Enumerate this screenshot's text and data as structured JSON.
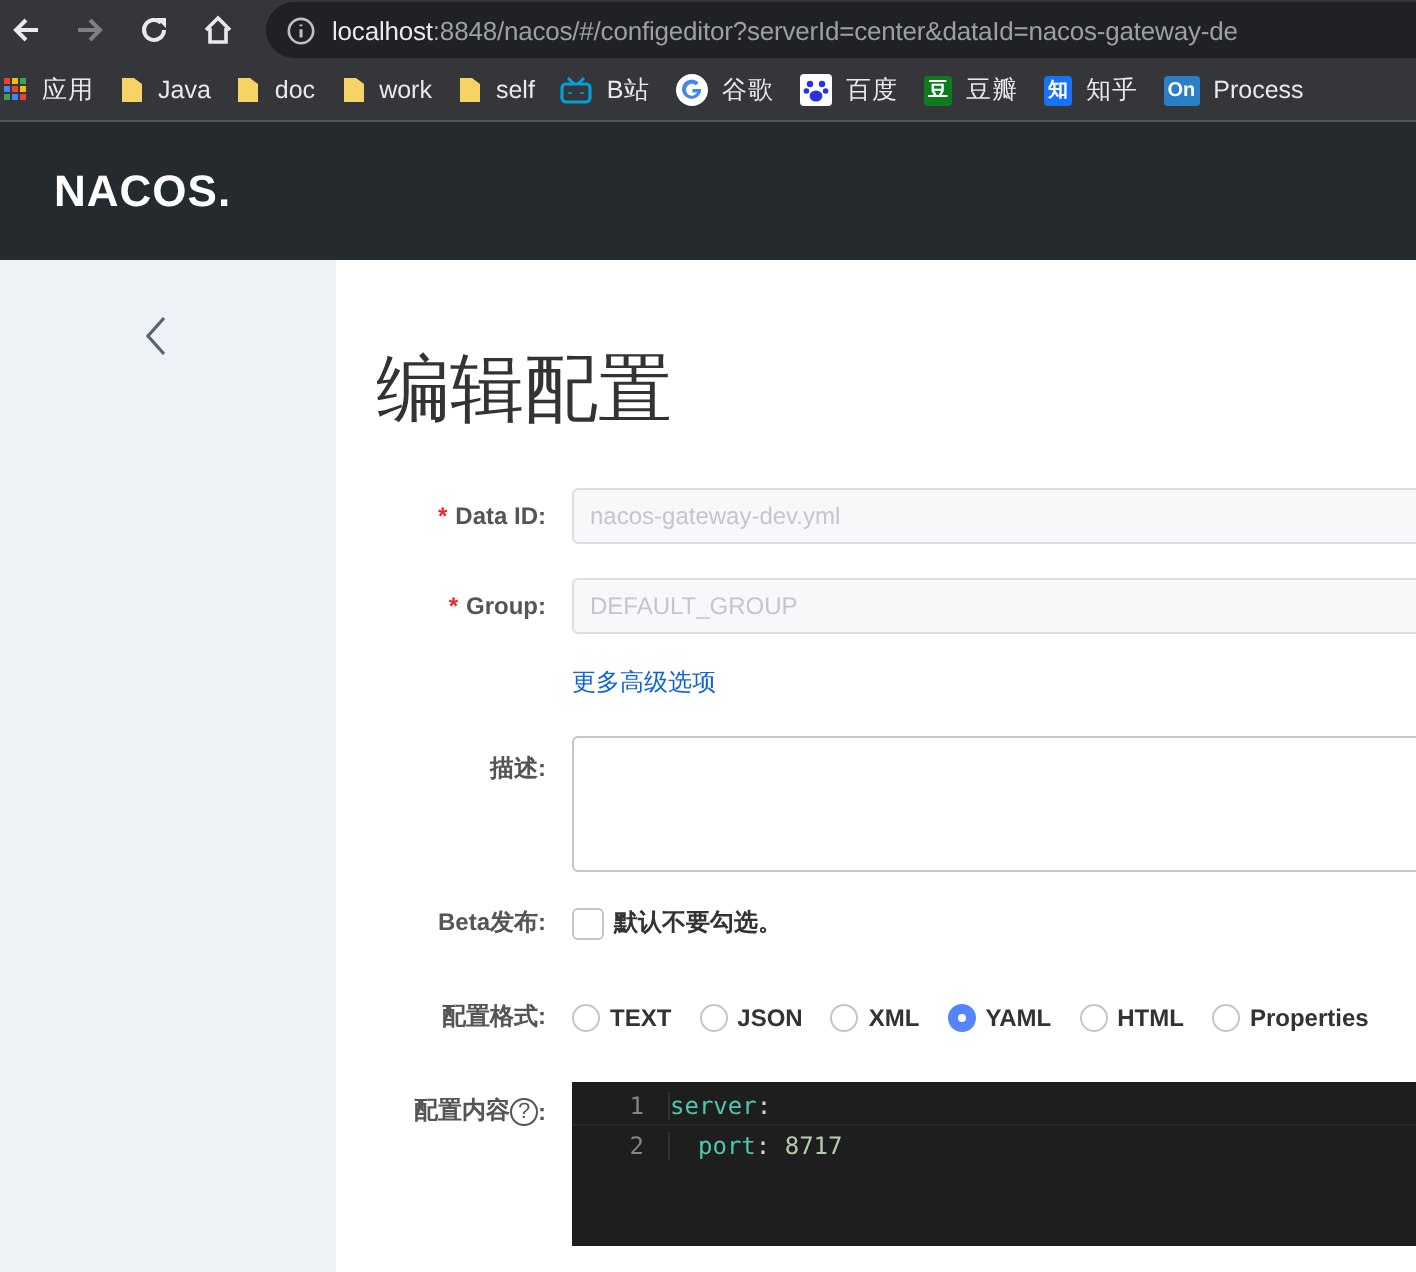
{
  "browser": {
    "url": "**localhost**:8848/nacos/#/configeditor?serverId=center&dataId=nacos-gateway-de",
    "bookmarks": [
      {
        "kind": "apps",
        "label": "应用"
      },
      {
        "kind": "folder",
        "label": "Java"
      },
      {
        "kind": "folder",
        "label": "doc"
      },
      {
        "kind": "folder",
        "label": "work"
      },
      {
        "kind": "folder",
        "label": "self"
      },
      {
        "kind": "tv",
        "label": "B站"
      },
      {
        "kind": "google",
        "label": "谷歌"
      },
      {
        "kind": "paw",
        "label": "百度"
      },
      {
        "kind": "badge",
        "badge": "豆",
        "color": "#0f7b1f",
        "label": "豆瓣"
      },
      {
        "kind": "badge",
        "badge": "知",
        "color": "#1772f6",
        "label": "知乎"
      },
      {
        "kind": "badge",
        "badge": "On",
        "color": "#2a7fc7",
        "label": "Process"
      }
    ]
  },
  "header": {
    "logo": "NACOS."
  },
  "page": {
    "title": "编辑配置",
    "fields": [
      {
        "kind": "input",
        "required_mark": "*",
        "label": "Data ID:",
        "value": "nacos-gateway-dev.yml",
        "disabled": true
      },
      {
        "kind": "input",
        "required_mark": "*",
        "label": "Group:",
        "value": "DEFAULT_GROUP",
        "disabled": true
      },
      {
        "kind": "link",
        "text": "更多高级选项"
      },
      {
        "kind": "textarea",
        "label": "描述:"
      },
      {
        "kind": "checkbox",
        "label": "Beta发布:",
        "text": "默认不要勾选。",
        "checked": false
      },
      {
        "kind": "radios",
        "label": "配置格式:",
        "options": [
          {
            "label": "TEXT",
            "selected": false
          },
          {
            "label": "JSON",
            "selected": false
          },
          {
            "label": "XML",
            "selected": false
          },
          {
            "label": "YAML",
            "selected": true
          },
          {
            "label": "HTML",
            "selected": false
          },
          {
            "label": "Properties",
            "selected": false
          }
        ]
      },
      {
        "kind": "editor",
        "label": "配置内容",
        "help": "?",
        "label_end": ":",
        "lines": [
          {
            "number": "1",
            "tokens": [
              {
                "kind": "key",
                "text": "server"
              },
              {
                "kind": "punct",
                "text": ":"
              }
            ]
          },
          {
            "number": "2",
            "tokens": [
              {
                "kind": "key",
                "text": "port"
              },
              {
                "kind": "punct",
                "text": ": "
              },
              {
                "kind": "number",
                "text": "8717"
              }
            ]
          }
        ]
      }
    ]
  }
}
